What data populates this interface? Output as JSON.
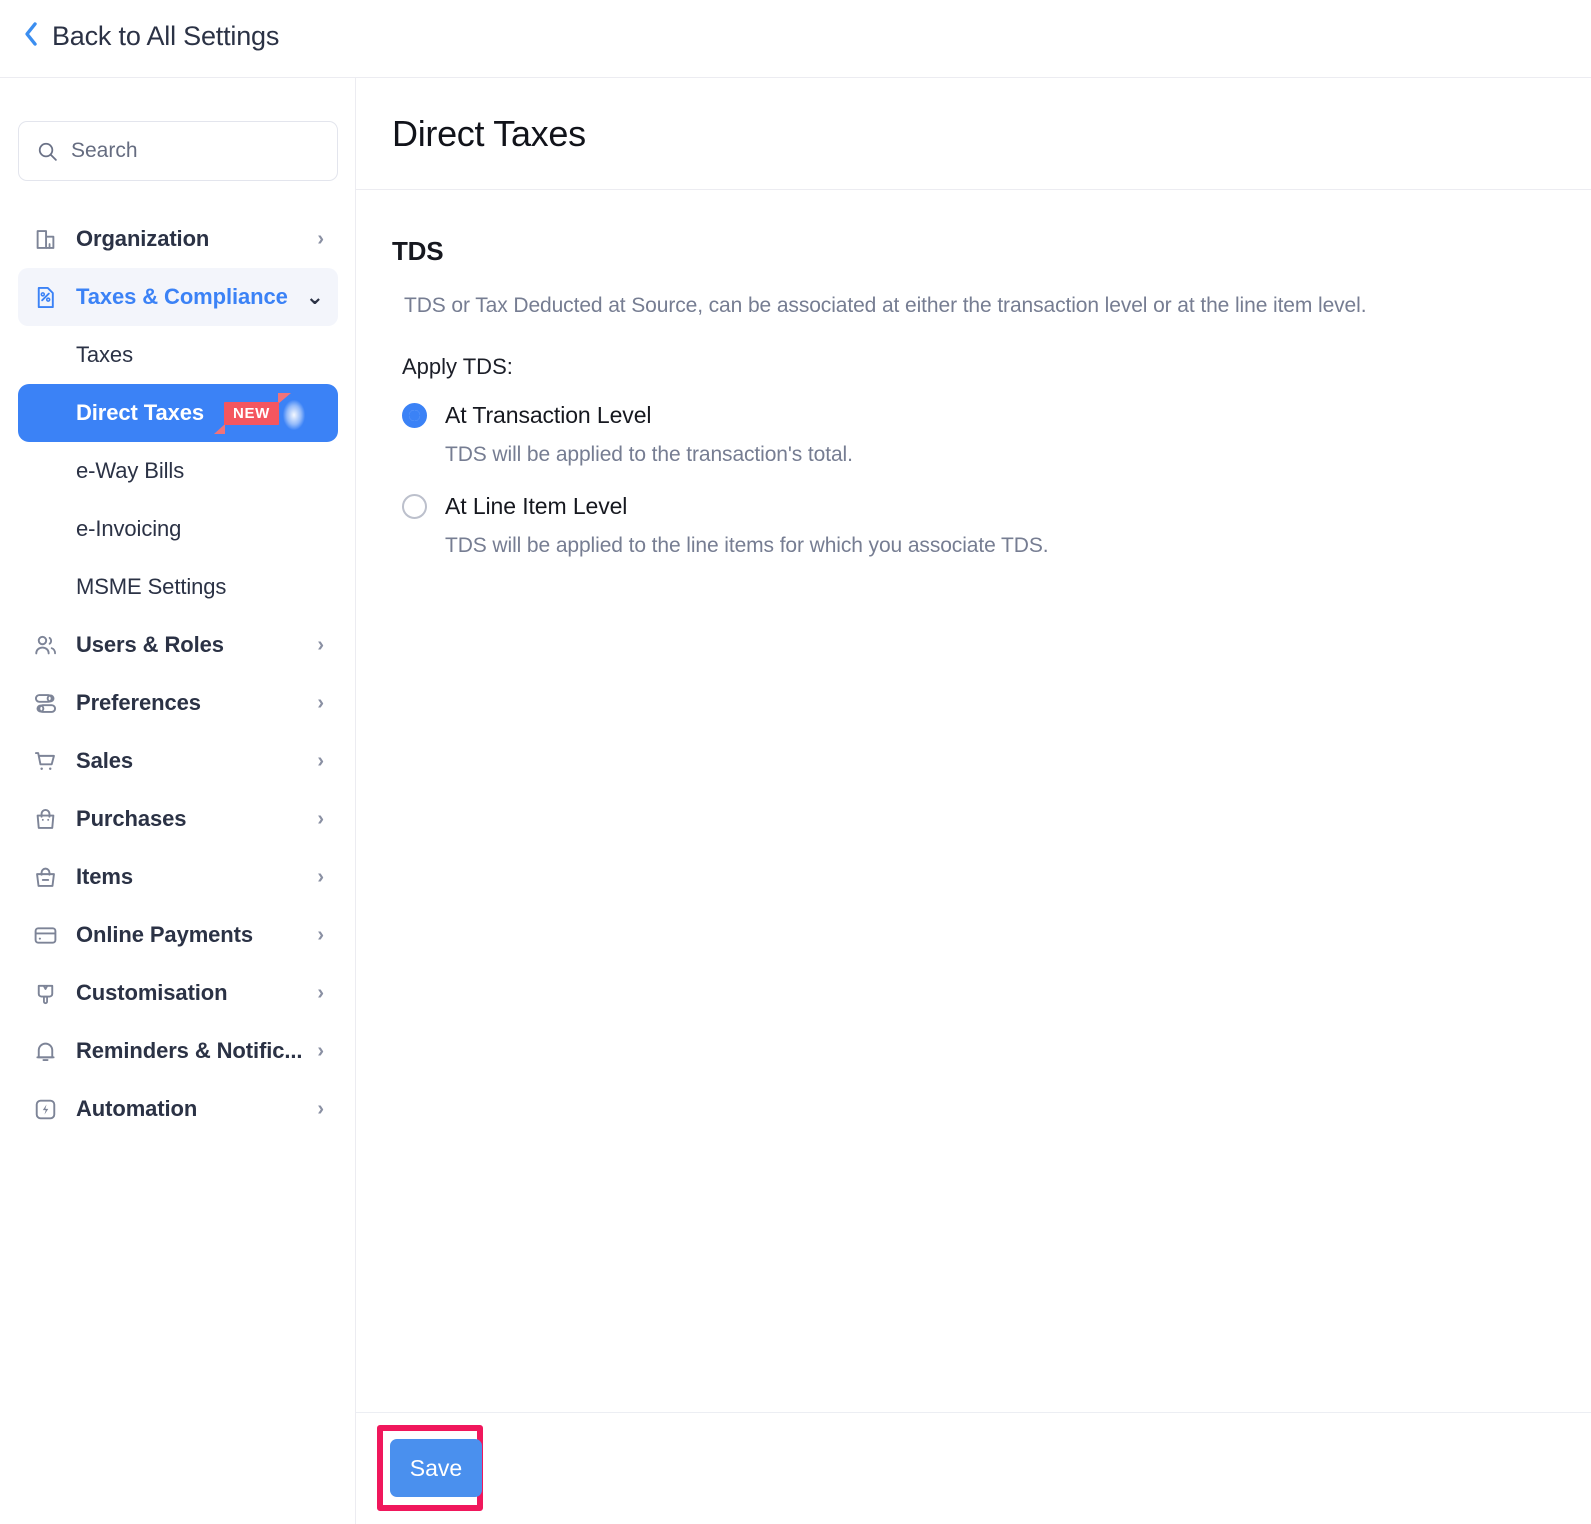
{
  "topbar": {
    "back_label": "Back to All Settings",
    "back_icon": "chevron-left-icon"
  },
  "sidebar": {
    "search": {
      "placeholder": "Search",
      "value": "",
      "icon": "search-icon"
    },
    "items": [
      {
        "label": "Organization",
        "icon": "building-icon",
        "chevron": "›",
        "state": "collapsed"
      },
      {
        "label": "Taxes & Compliance",
        "icon": "tax-document-percent-icon",
        "chevron": "⌄",
        "state": "expanded-active"
      },
      {
        "label": "Users & Roles",
        "icon": "users-icon",
        "chevron": "›",
        "state": "collapsed"
      },
      {
        "label": "Preferences",
        "icon": "sliders-icon",
        "chevron": "›",
        "state": "collapsed"
      },
      {
        "label": "Sales",
        "icon": "shopping-cart-icon",
        "chevron": "›",
        "state": "collapsed"
      },
      {
        "label": "Purchases",
        "icon": "shopping-bag-icon",
        "chevron": "›",
        "state": "collapsed"
      },
      {
        "label": "Items",
        "icon": "basket-icon",
        "chevron": "›",
        "state": "collapsed"
      },
      {
        "label": "Online Payments",
        "icon": "credit-card-icon",
        "chevron": "›",
        "state": "collapsed"
      },
      {
        "label": "Customisation",
        "icon": "paint-brush-icon",
        "chevron": "›",
        "state": "collapsed"
      },
      {
        "label": "Reminders & Notific...",
        "icon": "bell-icon",
        "chevron": "›",
        "state": "collapsed"
      },
      {
        "label": "Automation",
        "icon": "lightning-bolt-icon",
        "chevron": "›",
        "state": "collapsed"
      }
    ],
    "subitems": [
      {
        "label": "Taxes",
        "selected": false
      },
      {
        "label": "Direct Taxes",
        "selected": true,
        "badge": "NEW"
      },
      {
        "label": "e-Way Bills",
        "selected": false
      },
      {
        "label": "e-Invoicing",
        "selected": false
      },
      {
        "label": "MSME Settings",
        "selected": false
      }
    ]
  },
  "main": {
    "page_title": "Direct Taxes",
    "section_title": "TDS",
    "section_desc": "TDS or Tax Deducted at Source, can be associated at either the transaction level or at the line item level.",
    "field_label": "Apply TDS:",
    "options": [
      {
        "label": "At Transaction Level",
        "help": "TDS will be applied to the transaction's total.",
        "checked": true
      },
      {
        "label": "At Line Item Level",
        "help": "TDS will be applied to the line items for which you associate TDS.",
        "checked": false
      }
    ]
  },
  "footer": {
    "save_label": "Save"
  },
  "colors": {
    "accent_blue": "#3b82f6",
    "button_blue": "#4a90ee",
    "highlight_pink": "#f0175c",
    "badge_red": "#f4565f",
    "text_dark": "#2b3245",
    "text_muted": "#767d92",
    "active_group_bg": "#f3f5fb"
  }
}
